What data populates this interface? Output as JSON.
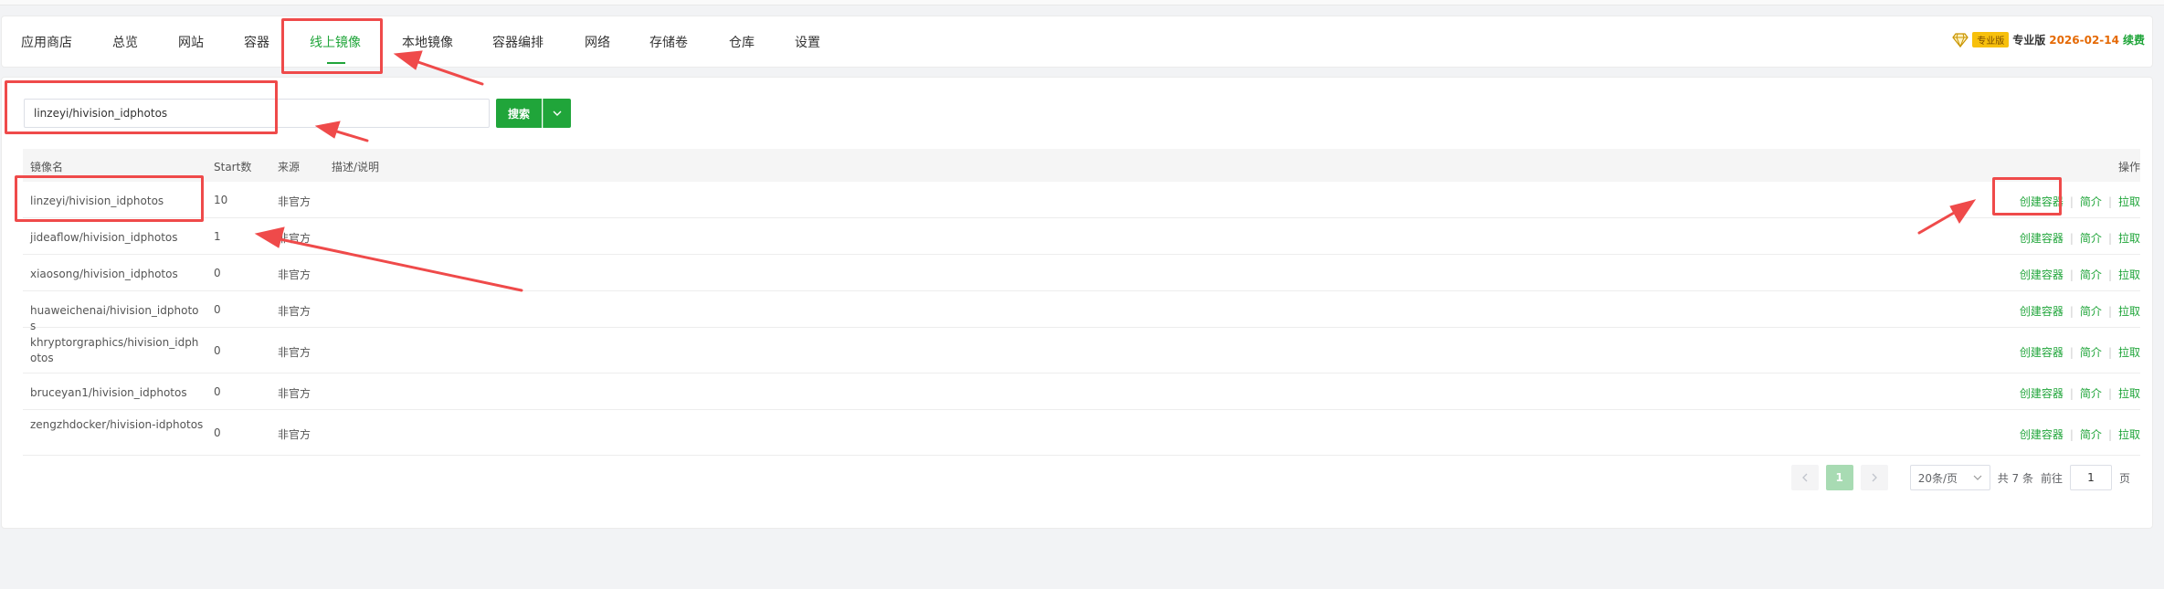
{
  "nav": {
    "tabs": [
      {
        "label": "应用商店",
        "name": "tab-app-store"
      },
      {
        "label": "总览",
        "name": "tab-overview"
      },
      {
        "label": "网站",
        "name": "tab-websites"
      },
      {
        "label": "容器",
        "name": "tab-containers"
      },
      {
        "label": "线上镜像",
        "name": "tab-online-images",
        "active": true
      },
      {
        "label": "本地镜像",
        "name": "tab-local-images"
      },
      {
        "label": "容器编排",
        "name": "tab-compose"
      },
      {
        "label": "网络",
        "name": "tab-network"
      },
      {
        "label": "存储卷",
        "name": "tab-volumes"
      },
      {
        "label": "仓库",
        "name": "tab-registry"
      },
      {
        "label": "设置",
        "name": "tab-settings"
      }
    ],
    "pro_badge": "专业版",
    "pro_text": "专业版",
    "pro_date": "2026-02-14",
    "renew": "续费"
  },
  "search": {
    "value": "linzeyi/hivision_idphotos",
    "button": "搜索"
  },
  "table": {
    "headers": {
      "name": "镜像名",
      "stars": "Start数",
      "source": "来源",
      "desc": "描述/说明",
      "ops": "操作"
    },
    "rows": [
      {
        "name": "linzeyi/hivision_idphotos",
        "stars": "10",
        "source": "非官方"
      },
      {
        "name": "jideaflow/hivision_idphotos",
        "stars": "1",
        "source": "非官方"
      },
      {
        "name": "xiaosong/hivision_idphotos",
        "stars": "0",
        "source": "非官方"
      },
      {
        "name": "huaweichenai/hivision_idphotos",
        "stars": "0",
        "source": "非官方"
      },
      {
        "name": "khryptorgraphics/hivision_idphotos",
        "stars": "0",
        "source": "非官方"
      },
      {
        "name": "bruceyan1/hivision_idphotos",
        "stars": "0",
        "source": "非官方"
      },
      {
        "name": "zengzhdocker/hivision-idphotos",
        "stars": "0",
        "source": "非官方"
      }
    ],
    "ops": {
      "create": "创建容器",
      "intro": "简介",
      "pull": "拉取"
    }
  },
  "pager": {
    "page": "1",
    "page_size": "20条/页",
    "total": "共 7 条",
    "goto_label": "前往",
    "goto_value": "1",
    "page_suffix": "页"
  },
  "colors": {
    "accent": "#20a53a",
    "annotation": "#ef4a4a"
  }
}
